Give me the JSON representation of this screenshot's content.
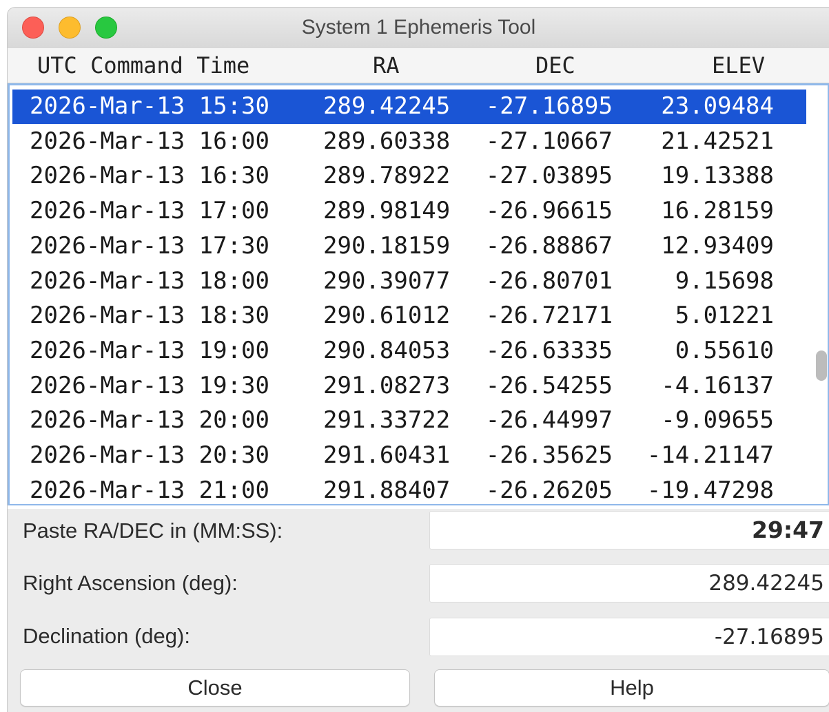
{
  "window": {
    "title": "System 1 Ephemeris Tool"
  },
  "table": {
    "columns": [
      "UTC Command Time",
      "RA",
      "DEC",
      "ELEV"
    ],
    "selected_index": 0,
    "rows": [
      {
        "time": "2026-Mar-13 15:30",
        "ra": "289.42245",
        "dec": "-27.16895",
        "elev": "23.09484"
      },
      {
        "time": "2026-Mar-13 16:00",
        "ra": "289.60338",
        "dec": "-27.10667",
        "elev": "21.42521"
      },
      {
        "time": "2026-Mar-13 16:30",
        "ra": "289.78922",
        "dec": "-27.03895",
        "elev": "19.13388"
      },
      {
        "time": "2026-Mar-13 17:00",
        "ra": "289.98149",
        "dec": "-26.96615",
        "elev": "16.28159"
      },
      {
        "time": "2026-Mar-13 17:30",
        "ra": "290.18159",
        "dec": "-26.88867",
        "elev": "12.93409"
      },
      {
        "time": "2026-Mar-13 18:00",
        "ra": "290.39077",
        "dec": "-26.80701",
        "elev": "9.15698"
      },
      {
        "time": "2026-Mar-13 18:30",
        "ra": "290.61012",
        "dec": "-26.72171",
        "elev": "5.01221"
      },
      {
        "time": "2026-Mar-13 19:00",
        "ra": "290.84053",
        "dec": "-26.63335",
        "elev": "0.55610"
      },
      {
        "time": "2026-Mar-13 19:30",
        "ra": "291.08273",
        "dec": "-26.54255",
        "elev": "-4.16137"
      },
      {
        "time": "2026-Mar-13 20:00",
        "ra": "291.33722",
        "dec": "-26.44997",
        "elev": "-9.09655"
      },
      {
        "time": "2026-Mar-13 20:30",
        "ra": "291.60431",
        "dec": "-26.35625",
        "elev": "-14.21147"
      },
      {
        "time": "2026-Mar-13 21:00",
        "ra": "291.88407",
        "dec": "-26.26205",
        "elev": "-19.47298"
      }
    ]
  },
  "form": {
    "paste_label": "Paste RA/DEC in (MM:SS):",
    "paste_value": "29:47",
    "ra_label": "Right Ascension (deg):",
    "ra_value": "289.42245",
    "dec_label": "Declination  (deg):",
    "dec_value": "-27.16895"
  },
  "buttons": {
    "close": "Close",
    "help": "Help"
  },
  "colors": {
    "selection": "#1a55d5",
    "close_light": "#fc5f57",
    "minimize_light": "#fdbc2e",
    "maximize_light": "#28c840"
  }
}
